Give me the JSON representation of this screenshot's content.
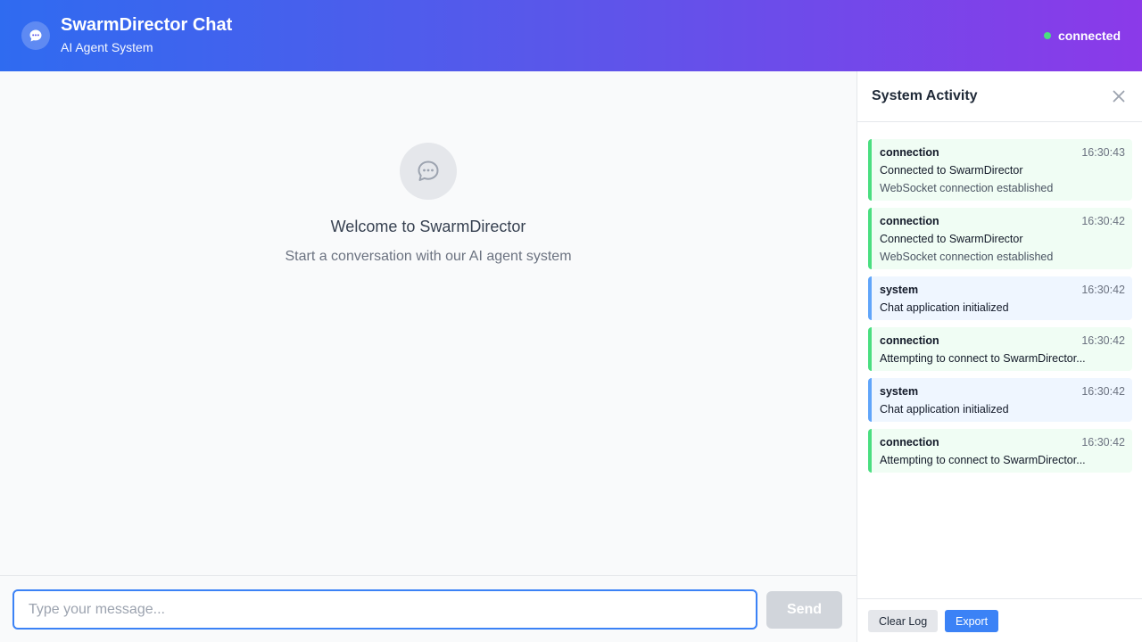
{
  "header": {
    "title": "SwarmDirector Chat",
    "subtitle": "AI Agent System",
    "logo_icon": "chat-bubble-icon",
    "status_text": "connected",
    "status_color": "#4ade80"
  },
  "welcome": {
    "icon": "chat-bubble-icon",
    "title": "Welcome to SwarmDirector",
    "subtitle": "Start a conversation with our AI agent system"
  },
  "composer": {
    "placeholder": "Type your message...",
    "value": "",
    "send_label": "Send"
  },
  "activity": {
    "title": "System Activity",
    "close_icon": "close-icon",
    "entries": [
      {
        "type": "connection",
        "time": "16:30:43",
        "message": "Connected to SwarmDirector",
        "detail": "WebSocket connection established"
      },
      {
        "type": "connection",
        "time": "16:30:42",
        "message": "Connected to SwarmDirector",
        "detail": "WebSocket connection established"
      },
      {
        "type": "system",
        "time": "16:30:42",
        "message": "Chat application initialized",
        "detail": ""
      },
      {
        "type": "connection",
        "time": "16:30:42",
        "message": "Attempting to connect to SwarmDirector...",
        "detail": ""
      },
      {
        "type": "system",
        "time": "16:30:42",
        "message": "Chat application initialized",
        "detail": ""
      },
      {
        "type": "connection",
        "time": "16:30:42",
        "message": "Attempting to connect to SwarmDirector...",
        "detail": ""
      }
    ],
    "clear_label": "Clear Log",
    "export_label": "Export"
  },
  "colors": {
    "connection_accent": "#4ade80",
    "system_accent": "#60a5fa",
    "primary": "#3b82f6"
  }
}
